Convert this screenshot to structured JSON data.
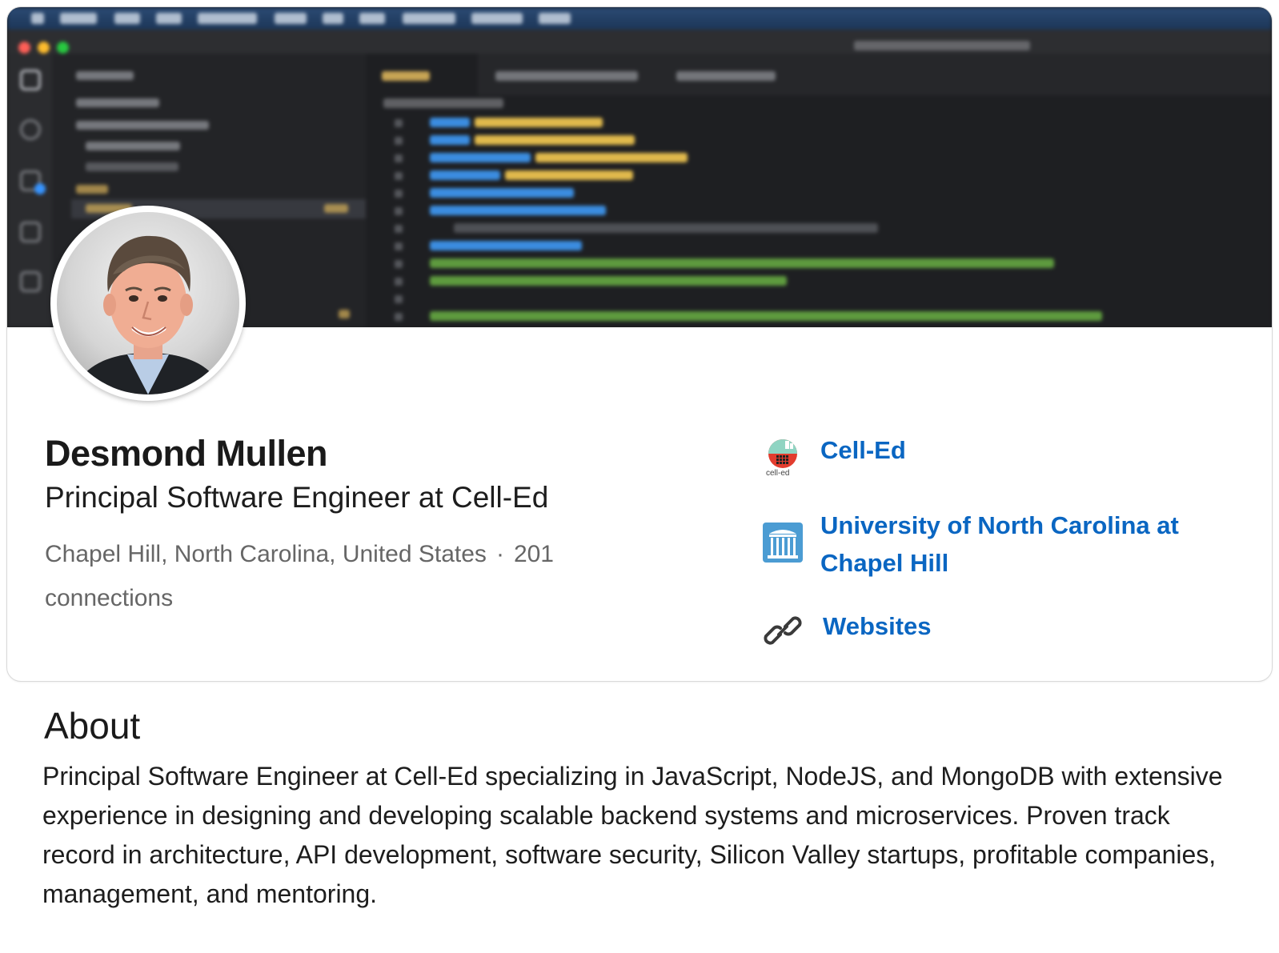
{
  "profile": {
    "name": "Desmond Mullen",
    "headline": "Principal Software Engineer at Cell-Ed",
    "location": "Chapel Hill, North Carolina, United States",
    "separator": "·",
    "connections": "201 connections"
  },
  "side_links": [
    {
      "label": "Cell-Ed",
      "icon": "cell-ed-logo",
      "logo_text": "cell-ed"
    },
    {
      "label": "University of North Carolina at Chapel Hill",
      "icon": "unc-old-well-logo"
    },
    {
      "label": "Websites",
      "icon": "link-icon"
    }
  ],
  "about": {
    "title": "About",
    "text": "Principal Software Engineer at Cell-Ed specializing in JavaScript, NodeJS, and MongoDB with extensive experience in designing and developing scalable backend systems and microservices. Proven track record in architecture, API development, software security, Silicon Valley startups, profitable companies, management, and mentoring."
  },
  "colors": {
    "link": "#0a66c2",
    "secondary_text": "#666666",
    "banner_bg": "#1e1f22"
  }
}
